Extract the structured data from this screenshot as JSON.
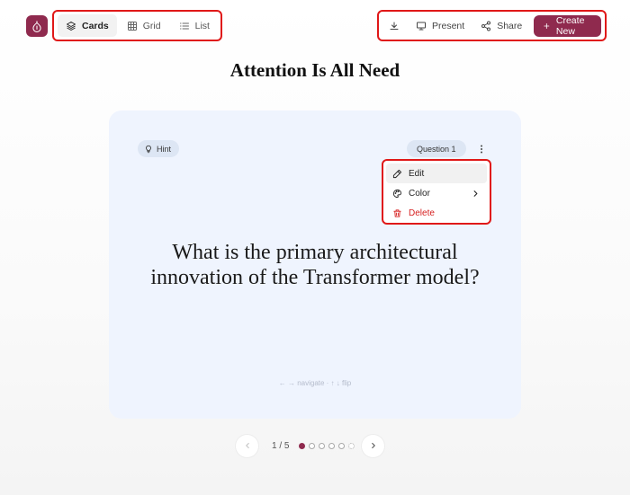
{
  "toolbar": {
    "views": [
      {
        "label": "Cards",
        "active": true
      },
      {
        "label": "Grid",
        "active": false
      },
      {
        "label": "List",
        "active": false
      }
    ],
    "present_label": "Present",
    "share_label": "Share",
    "create_label": "Create New"
  },
  "deck": {
    "title": "Attention Is All Need"
  },
  "card": {
    "hint_label": "Hint",
    "question_badge": "Question 1",
    "question_text": "What is the primary architectural innovation of the Transformer model?",
    "keyboard_hint": "← → navigate · ↑ ↓ flip"
  },
  "menu": {
    "edit_label": "Edit",
    "color_label": "Color",
    "delete_label": "Delete"
  },
  "pager": {
    "count_label": "1 / 5",
    "current": 1,
    "total": 5
  },
  "colors": {
    "brand": "#8f2a4e",
    "card_bg": "#eff4fe",
    "highlight": "#e01818",
    "danger": "#d62020"
  }
}
